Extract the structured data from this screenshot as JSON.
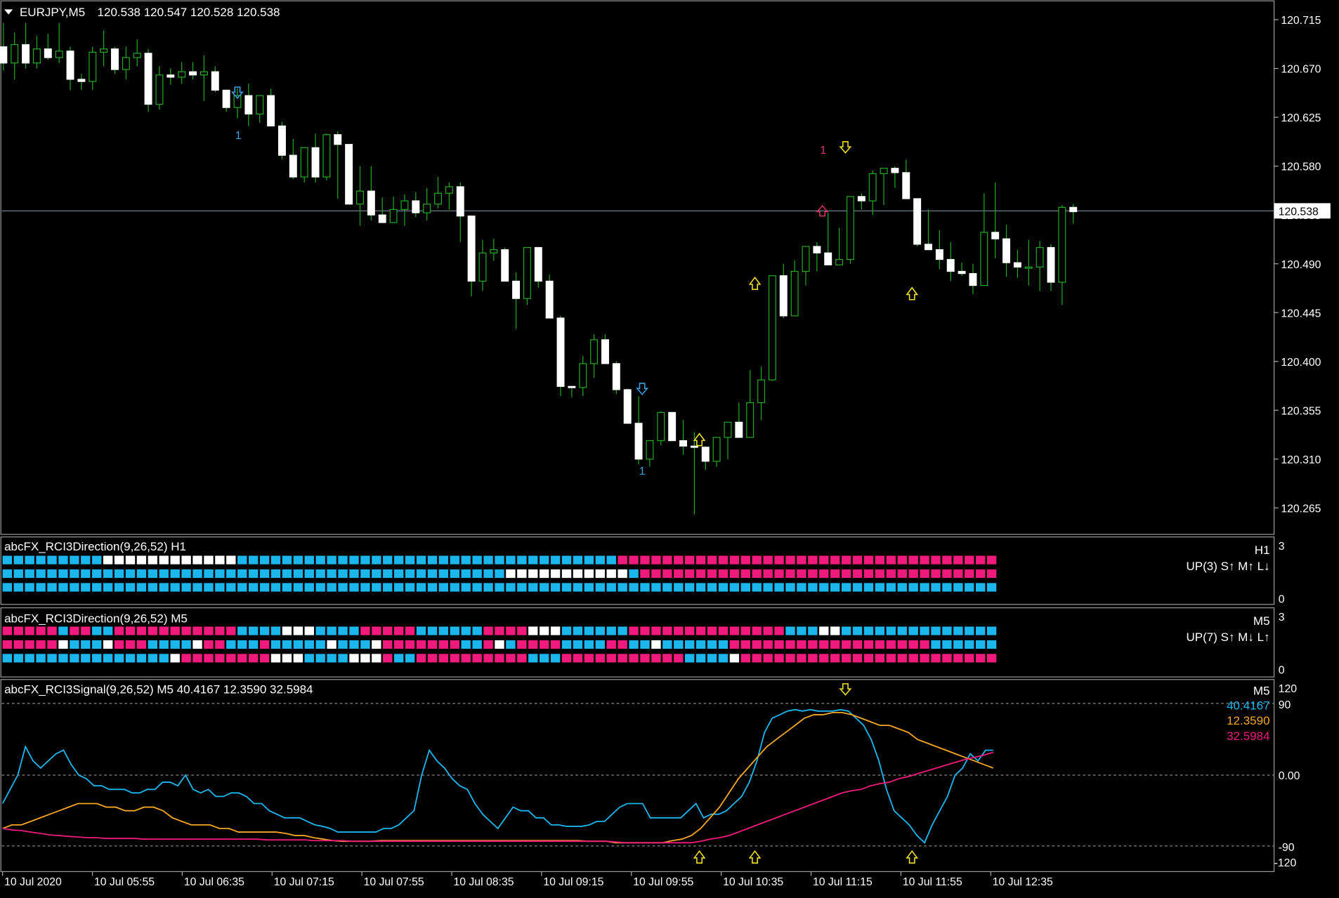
{
  "main": {
    "symbol_label": "EURJPY,M5",
    "ohlc": "120.538 120.547 120.528 120.538",
    "price_ticks": [
      "120.715",
      "120.670",
      "120.625",
      "120.580",
      "120.535",
      "120.490",
      "120.445",
      "120.400",
      "120.355",
      "120.310",
      "120.265"
    ],
    "current_price": "120.538",
    "labels": {
      "num_blue_1": "1",
      "num_blue_2": "1",
      "num_pink": "1"
    }
  },
  "panel1": {
    "title": "abcFX_RCI3Direction(9,26,52) H1",
    "tf": "H1",
    "status": "UP(3) S↑ M↑ L↓",
    "scale_top": "3",
    "scale_bottom": "0"
  },
  "panel2": {
    "title": "abcFX_RCI3Direction(9,26,52) M5",
    "tf": "M5",
    "status": "UP(7) S↑ M↓ L↑",
    "scale_top": "3",
    "scale_bottom": "0"
  },
  "panel3": {
    "title": "abcFX_RCI3Signal(9,26,52) M5 40.4167 12.3590 32.5984",
    "tf": "M5",
    "ticks": {
      "t120": "120",
      "t90": "90",
      "t0": "0.00",
      "tm90": "-90",
      "tm120": "-120"
    },
    "values": {
      "short": "40.4167",
      "mid": "12.3590",
      "long": "32.5984"
    }
  },
  "time_axis": [
    "10 Jul 2020",
    "10 Jul 05:55",
    "10 Jul 06:35",
    "10 Jul 07:15",
    "10 Jul 07:55",
    "10 Jul 08:35",
    "10 Jul 09:15",
    "10 Jul 09:55",
    "10 Jul 10:35",
    "10 Jul 11:15",
    "10 Jul 11:55",
    "10 Jul 12:35"
  ],
  "colors": {
    "bg": "#000000",
    "frame": "#aaaaaa",
    "bull_wick": "#22aa22",
    "bull_body": "#000000",
    "bear_body": "#ffffff",
    "rci_cyan": "#1ab6ec",
    "rci_pink": "#f01a7c",
    "rci_white": "#ffffff",
    "rci_orange": "#f5a623",
    "arrow_yellow": "#f0e020",
    "arrow_blue": "#3aa0e0",
    "label_pink": "#e0306c",
    "label_blue": "#3aa0e0",
    "price_line": "#7a8c99"
  },
  "chart_data": {
    "type": "candlestick",
    "y_range": [
      120.252,
      120.73
    ],
    "candles": [
      [
        120.69,
        120.712,
        120.668,
        120.675
      ],
      [
        120.675,
        120.703,
        120.66,
        120.692
      ],
      [
        120.692,
        120.712,
        120.67,
        120.675
      ],
      [
        120.675,
        120.7,
        120.67,
        120.688
      ],
      [
        120.688,
        120.702,
        120.678,
        120.68
      ],
      [
        120.68,
        120.712,
        120.675,
        120.686
      ],
      [
        120.686,
        120.69,
        120.65,
        120.66
      ],
      [
        120.66,
        120.665,
        120.65,
        120.658
      ],
      [
        120.658,
        120.69,
        120.65,
        120.685
      ],
      [
        120.685,
        120.705,
        120.672,
        120.688
      ],
      [
        120.688,
        120.69,
        120.665,
        120.669
      ],
      [
        120.669,
        120.69,
        120.66,
        120.68
      ],
      [
        120.68,
        120.697,
        120.672,
        120.684
      ],
      [
        120.684,
        120.688,
        120.63,
        120.637
      ],
      [
        120.637,
        120.672,
        120.632,
        120.664
      ],
      [
        120.664,
        120.67,
        120.655,
        120.662
      ],
      [
        120.662,
        120.676,
        120.656,
        120.667
      ],
      [
        120.667,
        120.676,
        120.66,
        120.664
      ],
      [
        120.664,
        120.682,
        120.64,
        120.667
      ],
      [
        120.667,
        120.672,
        120.648,
        120.65
      ],
      [
        120.65,
        120.65,
        120.63,
        120.634
      ],
      [
        120.634,
        120.652,
        120.624,
        120.645
      ],
      [
        120.645,
        120.656,
        120.617,
        120.628
      ],
      [
        120.628,
        120.645,
        120.62,
        120.645
      ],
      [
        120.645,
        120.651,
        120.64,
        120.617
      ],
      [
        120.617,
        120.621,
        120.586,
        120.59
      ],
      [
        120.59,
        120.605,
        120.568,
        120.57
      ],
      [
        120.57,
        120.597,
        120.565,
        120.597
      ],
      [
        120.597,
        120.61,
        120.565,
        120.57
      ],
      [
        120.57,
        120.61,
        120.567,
        120.609
      ],
      [
        120.609,
        120.612,
        120.55,
        120.6
      ],
      [
        120.6,
        120.6,
        120.553,
        120.545
      ],
      [
        120.545,
        120.58,
        120.525,
        120.557
      ],
      [
        120.557,
        120.58,
        120.53,
        120.535
      ],
      [
        120.535,
        120.551,
        120.53,
        120.528
      ],
      [
        120.528,
        120.552,
        120.533,
        120.54
      ],
      [
        120.54,
        120.554,
        120.525,
        120.548
      ],
      [
        120.548,
        120.556,
        120.533,
        120.537
      ],
      [
        120.537,
        120.56,
        120.53,
        120.545
      ],
      [
        120.545,
        120.57,
        120.541,
        120.555
      ],
      [
        120.555,
        120.565,
        120.54,
        120.561
      ],
      [
        120.561,
        120.565,
        120.51,
        120.534
      ],
      [
        120.534,
        120.534,
        120.46,
        120.474
      ],
      [
        120.474,
        120.512,
        120.465,
        120.5
      ],
      [
        120.5,
        120.513,
        120.493,
        120.503
      ],
      [
        120.503,
        120.505,
        120.487,
        120.474
      ],
      [
        120.474,
        120.482,
        120.43,
        120.458
      ],
      [
        120.458,
        120.49,
        120.452,
        120.505
      ],
      [
        120.505,
        120.5,
        120.468,
        120.474
      ],
      [
        120.474,
        120.48,
        120.45,
        120.44
      ],
      [
        120.44,
        120.442,
        120.368,
        120.377
      ],
      [
        120.377,
        120.375,
        120.367,
        120.376
      ],
      [
        120.376,
        120.405,
        120.368,
        120.398
      ],
      [
        120.398,
        120.425,
        120.385,
        120.42
      ],
      [
        120.42,
        120.425,
        120.4,
        120.398
      ],
      [
        120.398,
        120.4,
        120.37,
        120.374
      ],
      [
        120.374,
        120.375,
        120.343,
        120.343
      ],
      [
        120.343,
        120.368,
        120.305,
        120.31
      ],
      [
        120.31,
        120.324,
        120.303,
        120.327
      ],
      [
        120.327,
        120.354,
        120.323,
        120.353
      ],
      [
        120.353,
        120.346,
        120.342,
        120.327
      ],
      [
        120.327,
        120.346,
        120.314,
        120.322
      ],
      [
        120.322,
        120.335,
        120.259,
        120.321
      ],
      [
        120.321,
        120.322,
        120.3,
        120.308
      ],
      [
        120.308,
        120.327,
        120.303,
        120.33
      ],
      [
        120.33,
        120.344,
        120.31,
        120.344
      ],
      [
        120.344,
        120.362,
        120.343,
        120.33
      ],
      [
        120.33,
        120.392,
        120.33,
        120.362
      ],
      [
        120.362,
        120.395,
        120.346,
        120.383
      ],
      [
        120.383,
        120.436,
        120.382,
        120.479
      ],
      [
        120.479,
        120.49,
        120.44,
        120.442
      ],
      [
        120.442,
        120.493,
        120.443,
        120.483
      ],
      [
        120.483,
        120.499,
        120.47,
        120.506
      ],
      [
        120.506,
        120.51,
        120.483,
        120.5
      ],
      [
        120.5,
        120.537,
        120.496,
        120.489
      ],
      [
        120.489,
        120.523,
        120.489,
        120.494
      ],
      [
        120.494,
        120.552,
        120.49,
        120.552
      ],
      [
        120.552,
        120.555,
        120.54,
        120.548
      ],
      [
        120.548,
        120.576,
        120.535,
        120.573
      ],
      [
        120.573,
        120.575,
        120.544,
        120.578
      ],
      [
        120.578,
        120.58,
        120.56,
        120.574
      ],
      [
        120.574,
        120.586,
        120.56,
        120.55
      ],
      [
        120.55,
        120.55,
        120.506,
        120.508
      ],
      [
        120.508,
        120.54,
        120.505,
        120.503
      ],
      [
        120.503,
        120.521,
        120.485,
        120.494
      ],
      [
        120.494,
        120.51,
        120.474,
        120.483
      ],
      [
        120.483,
        120.491,
        120.479,
        120.481
      ],
      [
        120.481,
        120.49,
        120.462,
        120.47
      ],
      [
        120.47,
        120.555,
        120.47,
        120.519
      ],
      [
        120.519,
        120.565,
        120.495,
        120.513
      ],
      [
        120.513,
        120.526,
        120.478,
        120.491
      ],
      [
        120.491,
        120.503,
        120.477,
        120.487
      ],
      [
        120.487,
        120.512,
        120.47,
        120.487
      ],
      [
        120.487,
        120.511,
        120.465,
        120.505
      ],
      [
        120.505,
        120.508,
        120.465,
        120.473
      ],
      [
        120.473,
        120.544,
        120.452,
        120.542
      ],
      [
        120.542,
        120.545,
        120.527,
        120.538
      ]
    ],
    "rci_h1_grid": {
      "row1": "CCCCCCCCCCCCCCCCCCCCCCCCCCCCCCCCCCCCCCCCCCCCCCCCCCCCCCCPPPPPPPPPPPPPPPPPPPPPPPPPPPPPPPPPPPPPPP",
      "row2": "CCCCCCCCCCCCCCCCCCCCCCCCCCCCCCCCCCCCCCCCCCCCCWWWWWWWWWWWCPPPPPPPPPPPPPPPPPPPPPPPPPPPPPPPPPPPPPPP",
      "row3": "CCCCCCCCCCCCCCCCCCCCCCCCCCCCCCCCCCCCCCCCCCCCCCCCCCCCCCCCCCCCCCCCCCCCCCCCCCCCCCCCCCCCCCCCCCCCCCC",
      "row1_white_span": [
        9,
        20
      ]
    },
    "rci_m5_grid": {
      "row1": "PPPPPCPPCCPPPPPPPPPPPCCCCWWWCCCCPPPPPCCCCCCPPPPWWWCCCCCCPPPPPPPPPPPPPPCCCWWCCCCCCCCCCCCCCCCCCCPP",
      "row2": "PPPPPWCCCWPPPCCCCWPPCCCPCCCCCWCCCWPPPPPPPCCPWCPPPPCCCCPPCCWCCCCCCPPPPPPPPPPPPPPPPPPCCCCCCCCCCCCCCC",
      "row3": "CCCCCCCCCCCCCCCWPPPPPPPPWWWCCCCWWWPCCPPPPPPPPPPCCCPPPPPPPPPPPCCCCWPPPPPPPPPPPPPPPPPPPPPPPPPPPPPPP"
    },
    "rci_signal": {
      "y_range": [
        -120,
        120
      ],
      "short": [
        -40,
        -20,
        0,
        40,
        20,
        10,
        20,
        30,
        35,
        15,
        0,
        -5,
        -15,
        -15,
        -20,
        -20,
        -20,
        -25,
        -25,
        -20,
        -20,
        -10,
        -10,
        -15,
        0,
        -20,
        -25,
        -20,
        -30,
        -30,
        -25,
        -25,
        -30,
        -40,
        -40,
        -50,
        -55,
        -60,
        -60,
        -60,
        -65,
        -70,
        -72,
        -75,
        -80,
        -80,
        -80,
        -80,
        -80,
        -80,
        -75,
        -75,
        -70,
        -60,
        -50,
        0,
        35,
        20,
        10,
        -5,
        -15,
        -20,
        -40,
        -55,
        -65,
        -75,
        -60,
        -45,
        -50,
        -50,
        -60,
        -60,
        -70,
        -70,
        -72,
        -72,
        -72,
        -70,
        -65,
        -65,
        -55,
        -45,
        -40,
        -40,
        -40,
        -60,
        -60,
        -60,
        -60,
        -60,
        -50,
        -40,
        -60,
        -55,
        -55,
        -50,
        -40,
        -30,
        -10,
        20,
        60,
        80,
        85,
        90,
        92,
        90,
        92,
        90,
        90,
        90,
        92,
        90,
        80,
        70,
        50,
        20,
        -20,
        -50,
        -60,
        -70,
        -85,
        -95,
        -70,
        -50,
        -30,
        0,
        10,
        30,
        20,
        35,
        35
      ],
      "mid": [
        -75,
        -70,
        -70,
        -65,
        -60,
        -55,
        -50,
        -45,
        -40,
        -40,
        -40,
        -45,
        -45,
        -50,
        -50,
        -45,
        -45,
        -50,
        -60,
        -65,
        -70,
        -70,
        -70,
        -75,
        -75,
        -80,
        -80,
        -80,
        -80,
        -80,
        -82,
        -85,
        -85,
        -88,
        -90,
        -92,
        -93,
        -93,
        -93,
        -93,
        -92,
        -92,
        -92,
        -92,
        -92,
        -92,
        -92,
        -92,
        -92,
        -92,
        -92,
        -92,
        -92,
        -92,
        -92,
        -92,
        -92,
        -92,
        -92,
        -92,
        -92,
        -92,
        -93,
        -93,
        -93,
        -95,
        -95,
        -95,
        -95,
        -95,
        -95,
        -92,
        -90,
        -85,
        -75,
        -60,
        -45,
        -25,
        -5,
        10,
        25,
        40,
        50,
        60,
        70,
        80,
        85,
        85,
        88,
        88,
        85,
        80,
        75,
        70,
        70,
        65,
        60,
        50,
        45,
        40,
        35,
        30,
        25,
        20,
        15,
        10
      ],
      "long": [
        -75,
        -77,
        -78,
        -80,
        -82,
        -84,
        -85,
        -86,
        -87,
        -88,
        -88,
        -89,
        -89,
        -89,
        -89,
        -90,
        -90,
        -90,
        -90,
        -90,
        -90,
        -90,
        -90,
        -90,
        -90,
        -90,
        -90,
        -90,
        -91,
        -91,
        -91,
        -91,
        -91,
        -92,
        -92,
        -92,
        -92,
        -93,
        -93,
        -93,
        -93,
        -93,
        -93,
        -93,
        -93,
        -93,
        -93,
        -93,
        -93,
        -93,
        -93,
        -93,
        -93,
        -93,
        -93,
        -93,
        -93,
        -93,
        -93,
        -93,
        -93,
        -93,
        -93,
        -93,
        -93,
        -94,
        -95,
        -95,
        -95,
        -95,
        -95,
        -95,
        -95,
        -95,
        -93,
        -90,
        -88,
        -85,
        -80,
        -75,
        -70,
        -65,
        -60,
        -55,
        -50,
        -45,
        -40,
        -35,
        -30,
        -25,
        -22,
        -20,
        -15,
        -12,
        -10,
        -5,
        -2,
        2,
        6,
        10,
        14,
        18,
        22,
        25,
        28,
        32
      ]
    }
  }
}
